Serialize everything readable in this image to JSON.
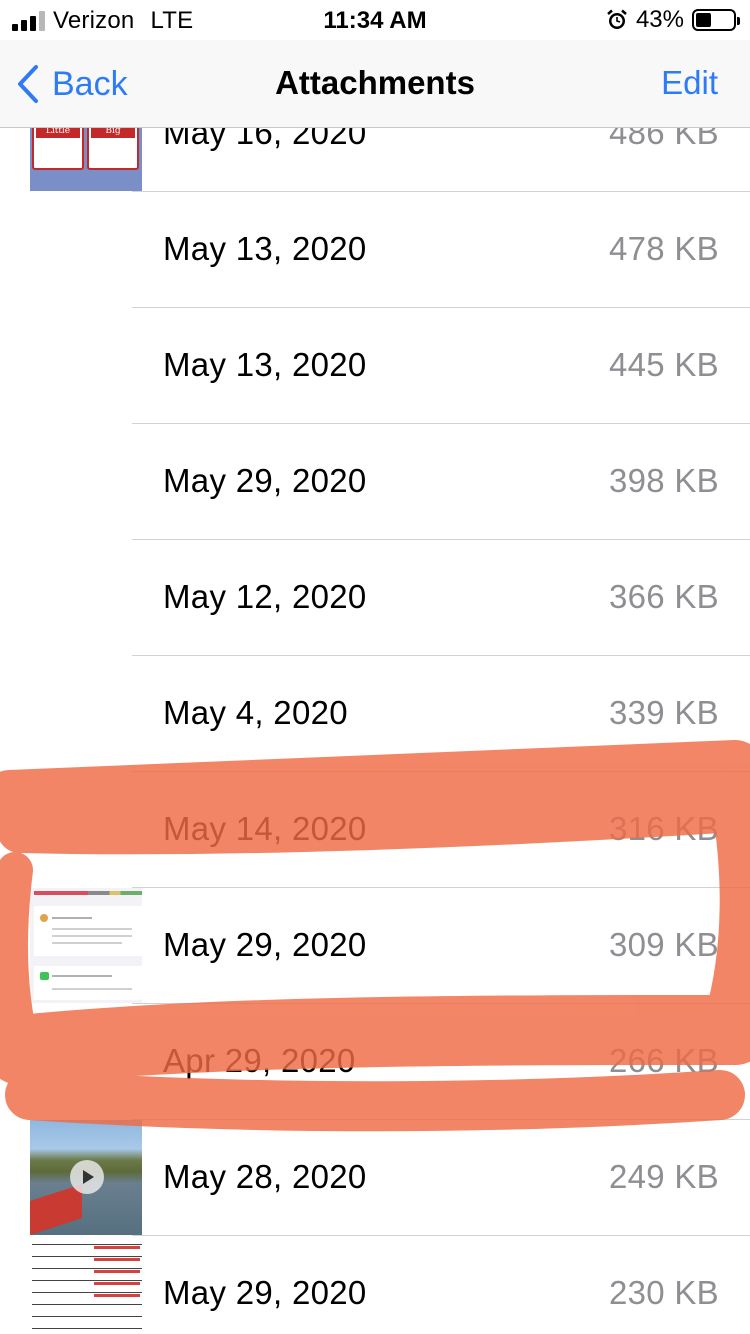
{
  "status_bar": {
    "carrier": "Verizon",
    "network": "LTE",
    "time": "11:34 AM",
    "battery_percent": "43%",
    "battery_level": 0.43,
    "signal_bars": 3,
    "icons": [
      "signal-bars-icon",
      "alarm-icon",
      "battery-icon"
    ]
  },
  "nav": {
    "back_label": "Back",
    "title": "Attachments",
    "edit_label": "Edit",
    "accent_color": "#2f7bf5"
  },
  "attachments": [
    {
      "date": "May 16, 2020",
      "size": "486 KB",
      "thumbnail": "little-debbie-image"
    },
    {
      "date": "May 13, 2020",
      "size": "478 KB",
      "thumbnail": ""
    },
    {
      "date": "May 13, 2020",
      "size": "445 KB",
      "thumbnail": ""
    },
    {
      "date": "May 29, 2020",
      "size": "398 KB",
      "thumbnail": ""
    },
    {
      "date": "May 12, 2020",
      "size": "366 KB",
      "thumbnail": ""
    },
    {
      "date": "May 4, 2020",
      "size": "339 KB",
      "thumbnail": ""
    },
    {
      "date": "May 14, 2020",
      "size": "316 KB",
      "thumbnail": ""
    },
    {
      "date": "May 29, 2020",
      "size": "309 KB",
      "thumbnail": "settings-screenshot"
    },
    {
      "date": "Apr 29, 2020",
      "size": "266 KB",
      "thumbnail": ""
    },
    {
      "date": "May 28, 2020",
      "size": "249 KB",
      "thumbnail": "lake-video"
    },
    {
      "date": "May 29, 2020",
      "size": "230 KB",
      "thumbnail": "document-image"
    }
  ],
  "thumbnail_text": {
    "little_debbie": "Little Debbie",
    "big_deborah": "Big Deborah"
  },
  "annotation": {
    "type": "orange highlighter scribble",
    "color": "#ef6b45"
  }
}
